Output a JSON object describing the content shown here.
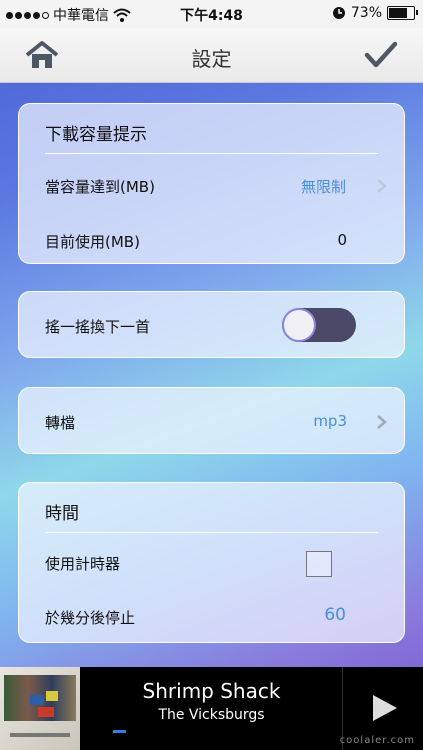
{
  "status_bar": {
    "carrier": "中華電信",
    "time": "下午4:48",
    "battery": "73%",
    "battery_level": 0.73
  },
  "nav": {
    "title": "設定"
  },
  "download_section": {
    "title": "下載容量提示",
    "limit_label": "當容量達到(MB)",
    "limit_value": "無限制",
    "usage_label": "目前使用(MB)",
    "usage_value": "0"
  },
  "shake_section": {
    "label": "搖一搖換下一首",
    "enabled": true
  },
  "convert_section": {
    "label": "轉檔",
    "value": "mp3"
  },
  "time_section": {
    "title": "時間",
    "timer_label": "使用計時器",
    "timer_checked": false,
    "stop_label": "於幾分後停止",
    "stop_value": "60"
  },
  "player": {
    "song": "Shrimp Shack",
    "artist": "The Vicksburgs",
    "progress": 0.03
  },
  "watermark": "coolaler.com",
  "colors": {
    "accent": "#4a90d9",
    "toggle_track": "#4b4868",
    "progress": "#2a7fe0"
  }
}
